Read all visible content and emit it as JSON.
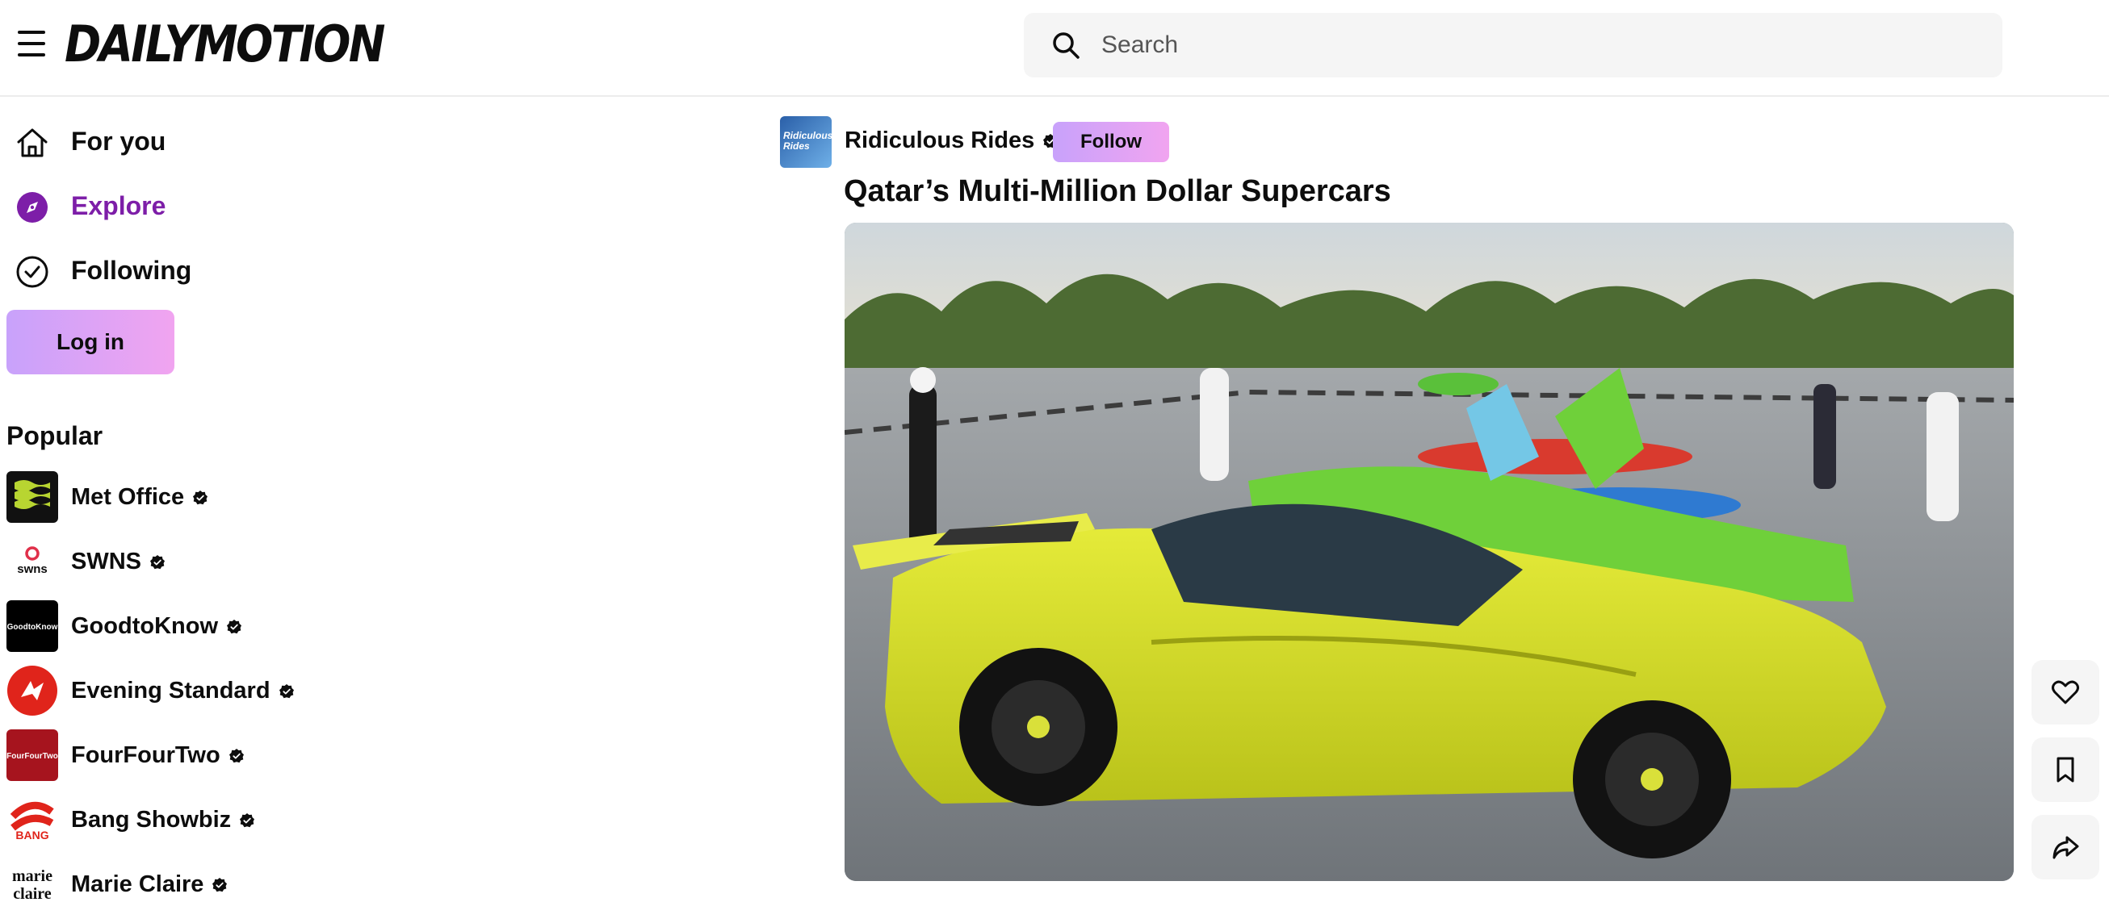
{
  "header": {
    "logo_text": "DAILYMOTION",
    "search_placeholder": "Search"
  },
  "sidebar": {
    "nav": [
      {
        "label": "For you",
        "icon": "home-icon"
      },
      {
        "label": "Explore",
        "icon": "compass-icon",
        "active": true
      },
      {
        "label": "Following",
        "icon": "check-circle-icon"
      }
    ],
    "login_label": "Log in",
    "popular_title": "Popular",
    "channels": [
      {
        "name": "Met Office",
        "verified": true,
        "avatar_text": "Met Office"
      },
      {
        "name": "SWNS",
        "verified": true,
        "avatar_text": "swns"
      },
      {
        "name": "GoodtoKnow",
        "verified": true,
        "avatar_text": "GoodtoKnow"
      },
      {
        "name": "Evening Standard",
        "verified": true,
        "avatar_text": ""
      },
      {
        "name": "FourFourTwo",
        "verified": true,
        "avatar_text": "FourFourTwo"
      },
      {
        "name": "Bang Showbiz",
        "verified": true,
        "avatar_text": "BANG"
      },
      {
        "name": "Marie Claire",
        "verified": true,
        "avatar_text": "marie claire"
      }
    ]
  },
  "main": {
    "channel_name": "Ridiculous Rides",
    "channel_avatar_text": "Ridiculous Rides",
    "follow_label": "Follow",
    "video_title": "Qatar’s Multi-Million Dollar Supercars"
  },
  "actions": [
    {
      "icon": "heart-icon"
    },
    {
      "icon": "bookmark-icon"
    },
    {
      "icon": "share-icon"
    }
  ],
  "colors": {
    "accent_purple": "#7d1ea8",
    "button_gradient_start": "#c8a2fb",
    "button_gradient_end": "#f1a4f0"
  }
}
